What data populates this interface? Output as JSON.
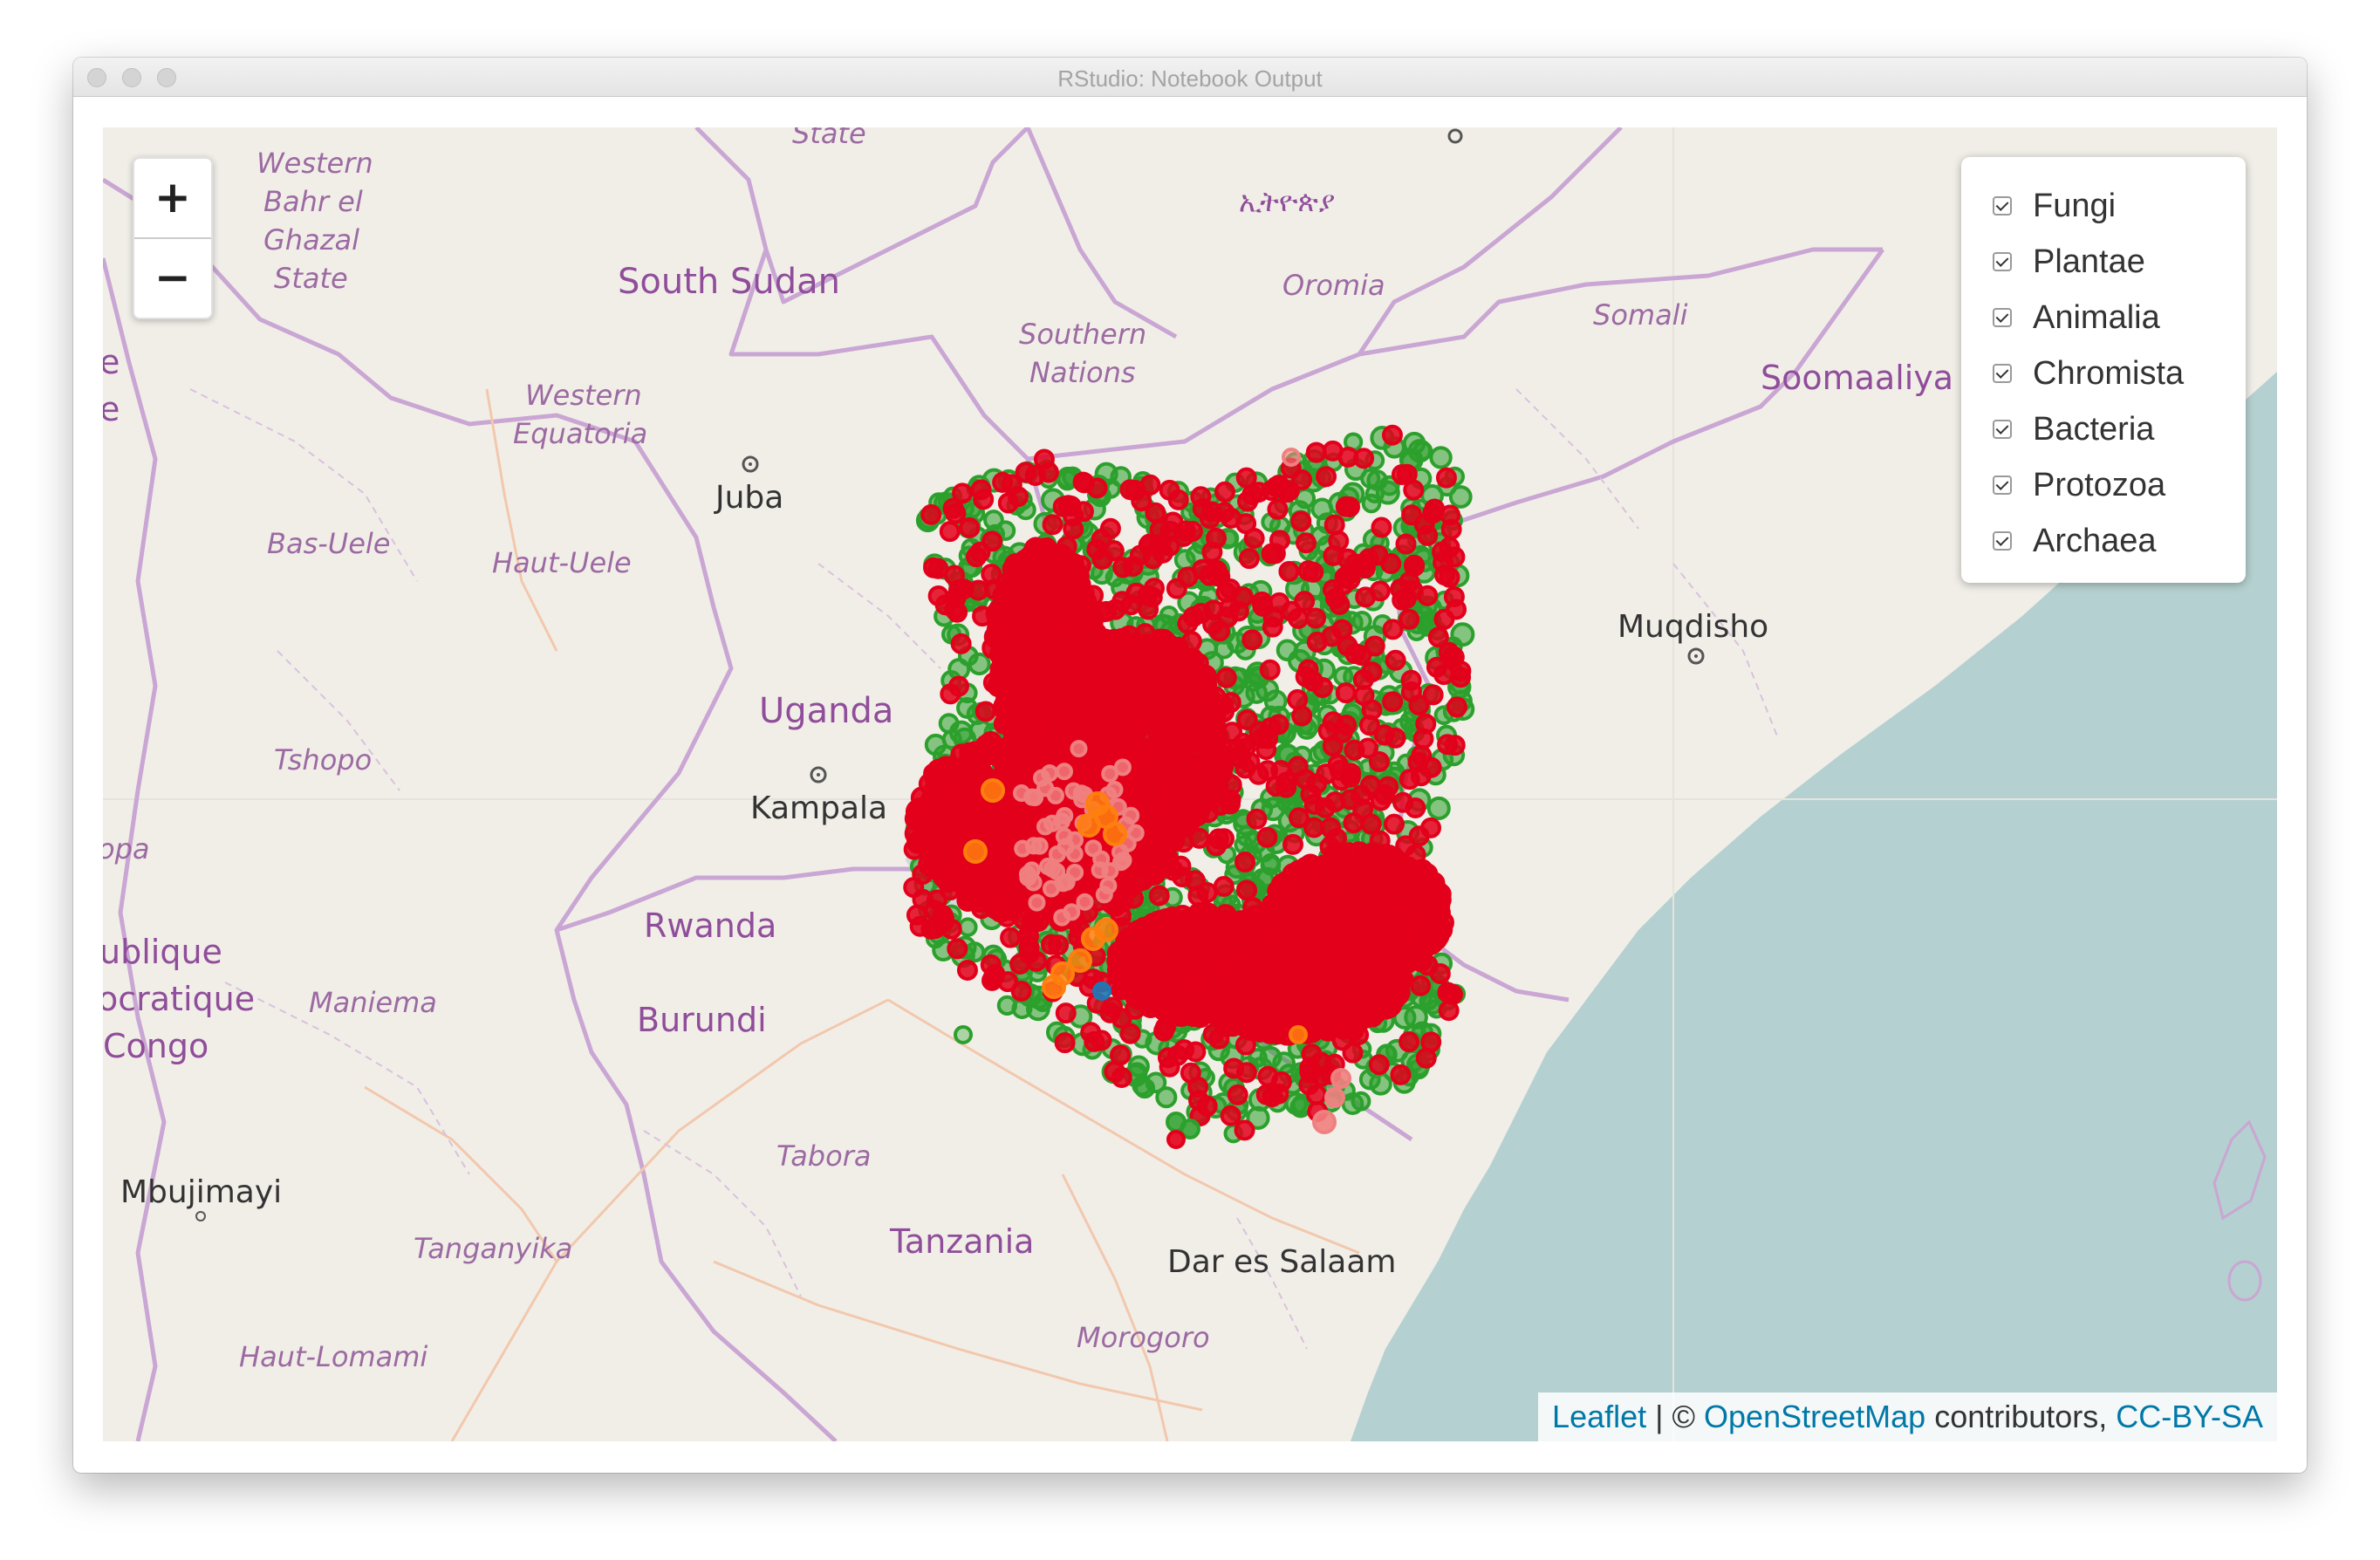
{
  "window": {
    "title": "RStudio: Notebook Output"
  },
  "map": {
    "zoom_in": "+",
    "zoom_out": "−",
    "layers": [
      {
        "label": "Fungi",
        "checked": true
      },
      {
        "label": "Plantae",
        "checked": true
      },
      {
        "label": "Animalia",
        "checked": true
      },
      {
        "label": "Chromista",
        "checked": true
      },
      {
        "label": "Bacteria",
        "checked": true
      },
      {
        "label": "Protozoa",
        "checked": true
      },
      {
        "label": "Archaea",
        "checked": true
      }
    ],
    "attribution": {
      "leaflet": "Leaflet",
      "sep": " | © ",
      "osm": "OpenStreetMap",
      "contributors": " contributors, ",
      "license": "CC-BY-SA"
    },
    "labels": {
      "country_south_sudan": "South Sudan",
      "country_uganda": "Uganda",
      "country_rwanda": "Rwanda",
      "country_burundi": "Burundi",
      "country_tanzania": "Tanzania",
      "country_somalia": "Soomaaliya",
      "country_drc_1": "ublique",
      "country_drc_2": "ocratique",
      "country_drc_3": "Congo",
      "country_edge_e": "e",
      "country_edge_e2": "e",
      "region_state_top": "State",
      "region_western_1": "Western",
      "region_western_2": "Bahr el",
      "region_western_3": "Ghazal",
      "region_western_4": "State",
      "region_western_eq_1": "Western",
      "region_western_eq_2": "Equatoria",
      "region_southern_1": "Southern",
      "region_southern_2": "Nations",
      "region_oromia": "Oromia",
      "region_somali": "Somali",
      "region_ethiopia": "ኢትዮጵያ",
      "region_bas_uele": "Bas-Uele",
      "region_haut_uele": "Haut-Uele",
      "region_tshopo": "Tshopo",
      "region_opa": "opa",
      "region_maniema": "Maniema",
      "region_tabora": "Tabora",
      "region_tanganyika": "Tanganyika",
      "region_haut_lomami": "Haut-Lomami",
      "region_morogoro": "Morogoro",
      "city_juba": "Juba",
      "city_kampala": "Kampala",
      "city_muqdisho": "Muqdisho",
      "city_dar": "Dar es Salaam",
      "city_mbujimayi": "Mbujimayi"
    },
    "colors": {
      "land": "#f1eee8",
      "water": "#b5d0d0",
      "border": "#c9a6d3",
      "animalia": "#e3001b",
      "plantae": "#2ca02c",
      "fungi": "#ff7f0e",
      "chromista": "#f08080",
      "bacteria": "#1f77b4"
    }
  }
}
